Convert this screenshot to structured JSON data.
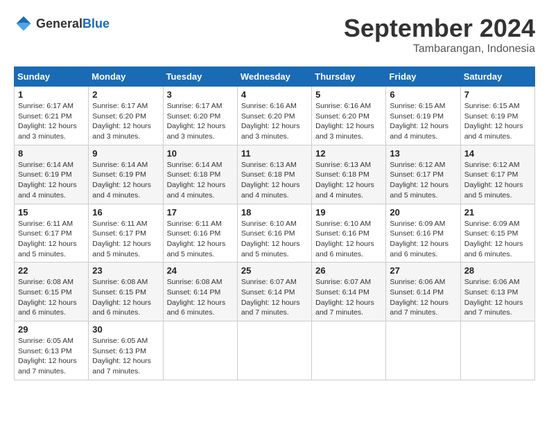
{
  "logo": {
    "text_general": "General",
    "text_blue": "Blue"
  },
  "header": {
    "month_title": "September 2024",
    "location": "Tambarangan, Indonesia"
  },
  "weekdays": [
    "Sunday",
    "Monday",
    "Tuesday",
    "Wednesday",
    "Thursday",
    "Friday",
    "Saturday"
  ],
  "weeks": [
    [
      {
        "day": 1,
        "sunrise": "6:17 AM",
        "sunset": "6:21 PM",
        "daylight": "12 hours and 3 minutes."
      },
      {
        "day": 2,
        "sunrise": "6:17 AM",
        "sunset": "6:20 PM",
        "daylight": "12 hours and 3 minutes."
      },
      {
        "day": 3,
        "sunrise": "6:17 AM",
        "sunset": "6:20 PM",
        "daylight": "12 hours and 3 minutes."
      },
      {
        "day": 4,
        "sunrise": "6:16 AM",
        "sunset": "6:20 PM",
        "daylight": "12 hours and 3 minutes."
      },
      {
        "day": 5,
        "sunrise": "6:16 AM",
        "sunset": "6:20 PM",
        "daylight": "12 hours and 3 minutes."
      },
      {
        "day": 6,
        "sunrise": "6:15 AM",
        "sunset": "6:19 PM",
        "daylight": "12 hours and 4 minutes."
      },
      {
        "day": 7,
        "sunrise": "6:15 AM",
        "sunset": "6:19 PM",
        "daylight": "12 hours and 4 minutes."
      }
    ],
    [
      {
        "day": 8,
        "sunrise": "6:14 AM",
        "sunset": "6:19 PM",
        "daylight": "12 hours and 4 minutes."
      },
      {
        "day": 9,
        "sunrise": "6:14 AM",
        "sunset": "6:19 PM",
        "daylight": "12 hours and 4 minutes."
      },
      {
        "day": 10,
        "sunrise": "6:14 AM",
        "sunset": "6:18 PM",
        "daylight": "12 hours and 4 minutes."
      },
      {
        "day": 11,
        "sunrise": "6:13 AM",
        "sunset": "6:18 PM",
        "daylight": "12 hours and 4 minutes."
      },
      {
        "day": 12,
        "sunrise": "6:13 AM",
        "sunset": "6:18 PM",
        "daylight": "12 hours and 4 minutes."
      },
      {
        "day": 13,
        "sunrise": "6:12 AM",
        "sunset": "6:17 PM",
        "daylight": "12 hours and 5 minutes."
      },
      {
        "day": 14,
        "sunrise": "6:12 AM",
        "sunset": "6:17 PM",
        "daylight": "12 hours and 5 minutes."
      }
    ],
    [
      {
        "day": 15,
        "sunrise": "6:11 AM",
        "sunset": "6:17 PM",
        "daylight": "12 hours and 5 minutes."
      },
      {
        "day": 16,
        "sunrise": "6:11 AM",
        "sunset": "6:17 PM",
        "daylight": "12 hours and 5 minutes."
      },
      {
        "day": 17,
        "sunrise": "6:11 AM",
        "sunset": "6:16 PM",
        "daylight": "12 hours and 5 minutes."
      },
      {
        "day": 18,
        "sunrise": "6:10 AM",
        "sunset": "6:16 PM",
        "daylight": "12 hours and 5 minutes."
      },
      {
        "day": 19,
        "sunrise": "6:10 AM",
        "sunset": "6:16 PM",
        "daylight": "12 hours and 6 minutes."
      },
      {
        "day": 20,
        "sunrise": "6:09 AM",
        "sunset": "6:16 PM",
        "daylight": "12 hours and 6 minutes."
      },
      {
        "day": 21,
        "sunrise": "6:09 AM",
        "sunset": "6:15 PM",
        "daylight": "12 hours and 6 minutes."
      }
    ],
    [
      {
        "day": 22,
        "sunrise": "6:08 AM",
        "sunset": "6:15 PM",
        "daylight": "12 hours and 6 minutes."
      },
      {
        "day": 23,
        "sunrise": "6:08 AM",
        "sunset": "6:15 PM",
        "daylight": "12 hours and 6 minutes."
      },
      {
        "day": 24,
        "sunrise": "6:08 AM",
        "sunset": "6:14 PM",
        "daylight": "12 hours and 6 minutes."
      },
      {
        "day": 25,
        "sunrise": "6:07 AM",
        "sunset": "6:14 PM",
        "daylight": "12 hours and 7 minutes."
      },
      {
        "day": 26,
        "sunrise": "6:07 AM",
        "sunset": "6:14 PM",
        "daylight": "12 hours and 7 minutes."
      },
      {
        "day": 27,
        "sunrise": "6:06 AM",
        "sunset": "6:14 PM",
        "daylight": "12 hours and 7 minutes."
      },
      {
        "day": 28,
        "sunrise": "6:06 AM",
        "sunset": "6:13 PM",
        "daylight": "12 hours and 7 minutes."
      }
    ],
    [
      {
        "day": 29,
        "sunrise": "6:05 AM",
        "sunset": "6:13 PM",
        "daylight": "12 hours and 7 minutes."
      },
      {
        "day": 30,
        "sunrise": "6:05 AM",
        "sunset": "6:13 PM",
        "daylight": "12 hours and 7 minutes."
      },
      null,
      null,
      null,
      null,
      null
    ]
  ]
}
